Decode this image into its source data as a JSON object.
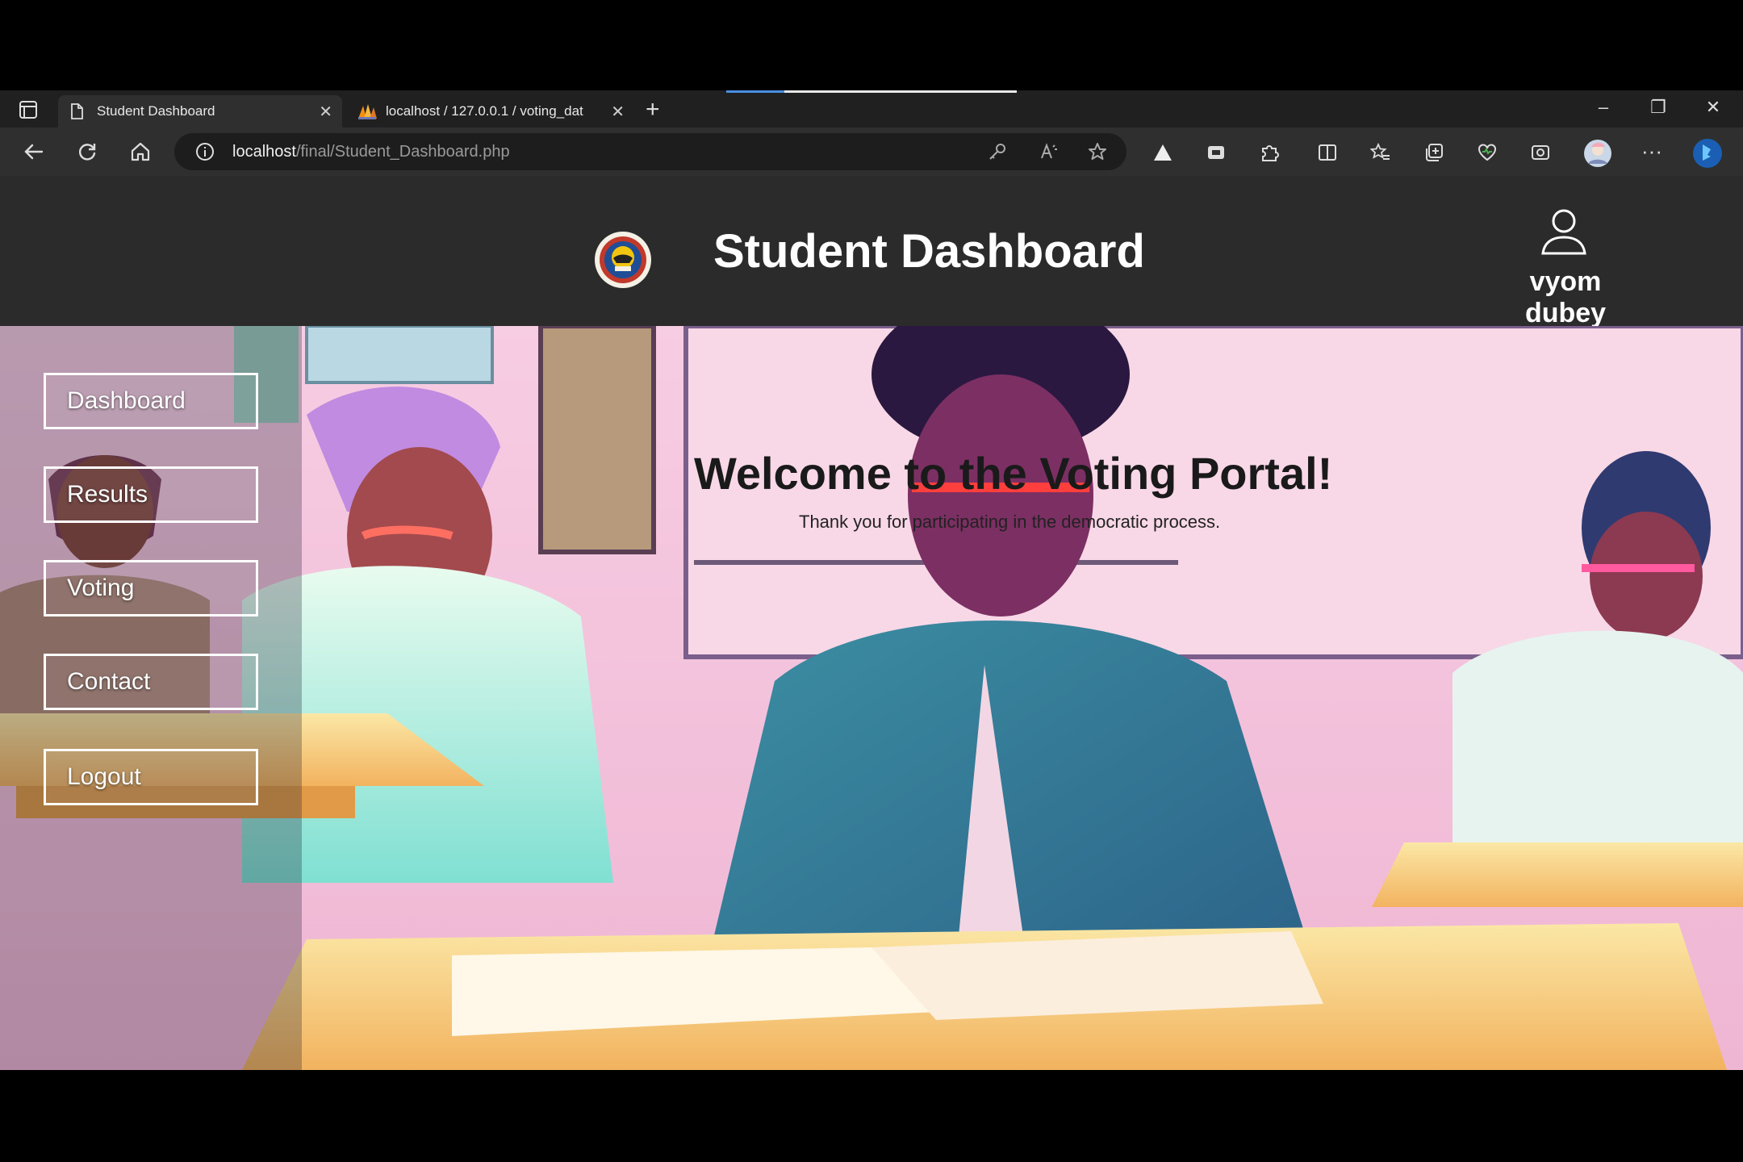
{
  "browser": {
    "tabs": [
      {
        "title": "Student Dashboard",
        "active": true
      },
      {
        "title": "localhost / 127.0.0.1 / voting_dat",
        "active": false
      }
    ],
    "new_tab_glyph": "+",
    "window_controls": {
      "minimize": "–",
      "restore": "❐",
      "close": "✕"
    },
    "address": {
      "host": "localhost",
      "path": "/final/Student_Dashboard.php"
    },
    "more_glyph": "···"
  },
  "header": {
    "title": "Student Dashboard",
    "user_name": "vyom dubey"
  },
  "sidebar": {
    "items": [
      {
        "label": "Dashboard"
      },
      {
        "label": "Results"
      },
      {
        "label": "Voting"
      },
      {
        "label": "Contact"
      },
      {
        "label": "Logout"
      }
    ]
  },
  "main": {
    "welcome_title": "Welcome to the Voting Portal!",
    "welcome_subtitle": "Thank you for participating in the democratic process."
  },
  "colors": {
    "header_bg": "#2b2b2b",
    "browser_chrome": "#2f2f2f",
    "accent_blue": "#4a90e2"
  }
}
